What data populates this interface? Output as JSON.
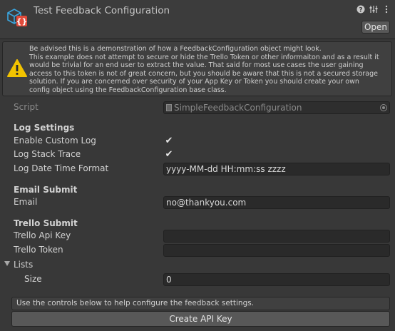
{
  "header": {
    "title": "Test Feedback Configuration",
    "open_label": "Open",
    "tools": [
      "help-icon",
      "settings-sliders-icon",
      "more-icon"
    ],
    "icon": "scriptable-object-icon"
  },
  "help_box": {
    "icon": "warning-icon",
    "lines": [
      "Be advised this is a demonstration of how a FeedbackConfiguration object might look.",
      "This example does not attempt to secure or hide the Trello Token or other informaiton and as a result it",
      "would be trivial for an end user to extract the value. That said for most use cases the user gaining",
      "access to this token is not of great concern, but you should be aware that this is not a secured storage",
      "solution. If you are concerned over security of your App Key or Token you should create your own",
      "config object using the FeedbackConfiguration base class."
    ]
  },
  "script": {
    "label": "Script",
    "value": "SimpleFeedbackConfiguration"
  },
  "log_settings": {
    "heading": "Log Settings",
    "enable_custom_log": {
      "label": "Enable Custom Log",
      "checked": true
    },
    "log_stack_trace": {
      "label": "Log Stack Trace",
      "checked": true
    },
    "date_format": {
      "label": "Log Date Time Format",
      "value": "yyyy-MM-dd HH:mm:ss zzzz"
    }
  },
  "email_submit": {
    "heading": "Email Submit",
    "email": {
      "label": "Email",
      "value": "no@thankyou.com"
    }
  },
  "trello_submit": {
    "heading": "Trello Submit",
    "api_key": {
      "label": "Trello Api Key",
      "value": ""
    },
    "token": {
      "label": "Trello Token",
      "value": ""
    },
    "lists": {
      "label": "Lists",
      "size_label": "Size",
      "size_value": "0"
    }
  },
  "footer": {
    "info": "Use the controls below to help configure the feedback settings.",
    "create_label": "Create API Key"
  },
  "colors": {
    "background": "#383838",
    "field": "#2a2a2a",
    "warning": "#f2c300",
    "accent": "#2fa4d9"
  }
}
